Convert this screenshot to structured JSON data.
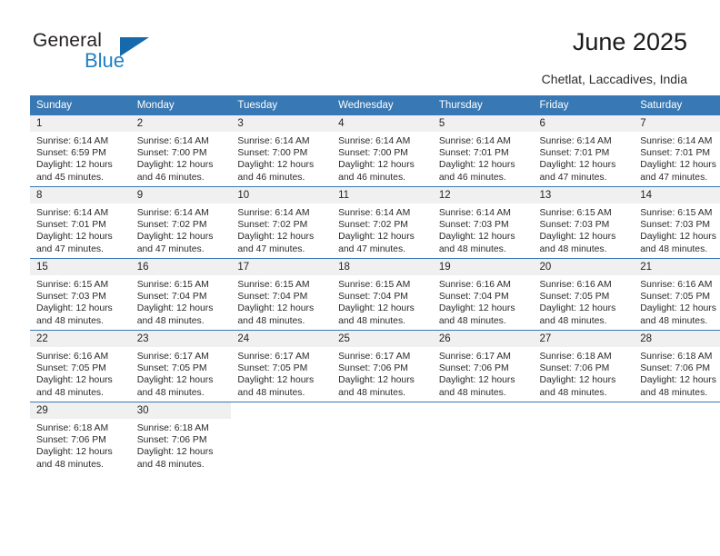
{
  "brand": {
    "name_part1": "General",
    "name_part2": "Blue",
    "color_dark": "#231f20",
    "color_blue": "#1f7fc4"
  },
  "header": {
    "title": "June 2025",
    "subtitle": "Chetlat, Laccadives, India"
  },
  "theme": {
    "header_bg": "#3878b4",
    "header_text": "#ffffff",
    "daynum_bg": "#f0f0f0",
    "separator": "#3878b4",
    "body_text": "#2a2a2a"
  },
  "weekday_headers": [
    "Sunday",
    "Monday",
    "Tuesday",
    "Wednesday",
    "Thursday",
    "Friday",
    "Saturday"
  ],
  "weeks": [
    [
      {
        "day": "1",
        "sunrise": "Sunrise: 6:14 AM",
        "sunset": "Sunset: 6:59 PM",
        "daylight1": "Daylight: 12 hours",
        "daylight2": "and 45 minutes."
      },
      {
        "day": "2",
        "sunrise": "Sunrise: 6:14 AM",
        "sunset": "Sunset: 7:00 PM",
        "daylight1": "Daylight: 12 hours",
        "daylight2": "and 46 minutes."
      },
      {
        "day": "3",
        "sunrise": "Sunrise: 6:14 AM",
        "sunset": "Sunset: 7:00 PM",
        "daylight1": "Daylight: 12 hours",
        "daylight2": "and 46 minutes."
      },
      {
        "day": "4",
        "sunrise": "Sunrise: 6:14 AM",
        "sunset": "Sunset: 7:00 PM",
        "daylight1": "Daylight: 12 hours",
        "daylight2": "and 46 minutes."
      },
      {
        "day": "5",
        "sunrise": "Sunrise: 6:14 AM",
        "sunset": "Sunset: 7:01 PM",
        "daylight1": "Daylight: 12 hours",
        "daylight2": "and 46 minutes."
      },
      {
        "day": "6",
        "sunrise": "Sunrise: 6:14 AM",
        "sunset": "Sunset: 7:01 PM",
        "daylight1": "Daylight: 12 hours",
        "daylight2": "and 47 minutes."
      },
      {
        "day": "7",
        "sunrise": "Sunrise: 6:14 AM",
        "sunset": "Sunset: 7:01 PM",
        "daylight1": "Daylight: 12 hours",
        "daylight2": "and 47 minutes."
      }
    ],
    [
      {
        "day": "8",
        "sunrise": "Sunrise: 6:14 AM",
        "sunset": "Sunset: 7:01 PM",
        "daylight1": "Daylight: 12 hours",
        "daylight2": "and 47 minutes."
      },
      {
        "day": "9",
        "sunrise": "Sunrise: 6:14 AM",
        "sunset": "Sunset: 7:02 PM",
        "daylight1": "Daylight: 12 hours",
        "daylight2": "and 47 minutes."
      },
      {
        "day": "10",
        "sunrise": "Sunrise: 6:14 AM",
        "sunset": "Sunset: 7:02 PM",
        "daylight1": "Daylight: 12 hours",
        "daylight2": "and 47 minutes."
      },
      {
        "day": "11",
        "sunrise": "Sunrise: 6:14 AM",
        "sunset": "Sunset: 7:02 PM",
        "daylight1": "Daylight: 12 hours",
        "daylight2": "and 47 minutes."
      },
      {
        "day": "12",
        "sunrise": "Sunrise: 6:14 AM",
        "sunset": "Sunset: 7:03 PM",
        "daylight1": "Daylight: 12 hours",
        "daylight2": "and 48 minutes."
      },
      {
        "day": "13",
        "sunrise": "Sunrise: 6:15 AM",
        "sunset": "Sunset: 7:03 PM",
        "daylight1": "Daylight: 12 hours",
        "daylight2": "and 48 minutes."
      },
      {
        "day": "14",
        "sunrise": "Sunrise: 6:15 AM",
        "sunset": "Sunset: 7:03 PM",
        "daylight1": "Daylight: 12 hours",
        "daylight2": "and 48 minutes."
      }
    ],
    [
      {
        "day": "15",
        "sunrise": "Sunrise: 6:15 AM",
        "sunset": "Sunset: 7:03 PM",
        "daylight1": "Daylight: 12 hours",
        "daylight2": "and 48 minutes."
      },
      {
        "day": "16",
        "sunrise": "Sunrise: 6:15 AM",
        "sunset": "Sunset: 7:04 PM",
        "daylight1": "Daylight: 12 hours",
        "daylight2": "and 48 minutes."
      },
      {
        "day": "17",
        "sunrise": "Sunrise: 6:15 AM",
        "sunset": "Sunset: 7:04 PM",
        "daylight1": "Daylight: 12 hours",
        "daylight2": "and 48 minutes."
      },
      {
        "day": "18",
        "sunrise": "Sunrise: 6:15 AM",
        "sunset": "Sunset: 7:04 PM",
        "daylight1": "Daylight: 12 hours",
        "daylight2": "and 48 minutes."
      },
      {
        "day": "19",
        "sunrise": "Sunrise: 6:16 AM",
        "sunset": "Sunset: 7:04 PM",
        "daylight1": "Daylight: 12 hours",
        "daylight2": "and 48 minutes."
      },
      {
        "day": "20",
        "sunrise": "Sunrise: 6:16 AM",
        "sunset": "Sunset: 7:05 PM",
        "daylight1": "Daylight: 12 hours",
        "daylight2": "and 48 minutes."
      },
      {
        "day": "21",
        "sunrise": "Sunrise: 6:16 AM",
        "sunset": "Sunset: 7:05 PM",
        "daylight1": "Daylight: 12 hours",
        "daylight2": "and 48 minutes."
      }
    ],
    [
      {
        "day": "22",
        "sunrise": "Sunrise: 6:16 AM",
        "sunset": "Sunset: 7:05 PM",
        "daylight1": "Daylight: 12 hours",
        "daylight2": "and 48 minutes."
      },
      {
        "day": "23",
        "sunrise": "Sunrise: 6:17 AM",
        "sunset": "Sunset: 7:05 PM",
        "daylight1": "Daylight: 12 hours",
        "daylight2": "and 48 minutes."
      },
      {
        "day": "24",
        "sunrise": "Sunrise: 6:17 AM",
        "sunset": "Sunset: 7:05 PM",
        "daylight1": "Daylight: 12 hours",
        "daylight2": "and 48 minutes."
      },
      {
        "day": "25",
        "sunrise": "Sunrise: 6:17 AM",
        "sunset": "Sunset: 7:06 PM",
        "daylight1": "Daylight: 12 hours",
        "daylight2": "and 48 minutes."
      },
      {
        "day": "26",
        "sunrise": "Sunrise: 6:17 AM",
        "sunset": "Sunset: 7:06 PM",
        "daylight1": "Daylight: 12 hours",
        "daylight2": "and 48 minutes."
      },
      {
        "day": "27",
        "sunrise": "Sunrise: 6:18 AM",
        "sunset": "Sunset: 7:06 PM",
        "daylight1": "Daylight: 12 hours",
        "daylight2": "and 48 minutes."
      },
      {
        "day": "28",
        "sunrise": "Sunrise: 6:18 AM",
        "sunset": "Sunset: 7:06 PM",
        "daylight1": "Daylight: 12 hours",
        "daylight2": "and 48 minutes."
      }
    ],
    [
      {
        "day": "29",
        "sunrise": "Sunrise: 6:18 AM",
        "sunset": "Sunset: 7:06 PM",
        "daylight1": "Daylight: 12 hours",
        "daylight2": "and 48 minutes."
      },
      {
        "day": "30",
        "sunrise": "Sunrise: 6:18 AM",
        "sunset": "Sunset: 7:06 PM",
        "daylight1": "Daylight: 12 hours",
        "daylight2": "and 48 minutes."
      },
      {
        "day": "",
        "sunrise": "",
        "sunset": "",
        "daylight1": "",
        "daylight2": ""
      },
      {
        "day": "",
        "sunrise": "",
        "sunset": "",
        "daylight1": "",
        "daylight2": ""
      },
      {
        "day": "",
        "sunrise": "",
        "sunset": "",
        "daylight1": "",
        "daylight2": ""
      },
      {
        "day": "",
        "sunrise": "",
        "sunset": "",
        "daylight1": "",
        "daylight2": ""
      },
      {
        "day": "",
        "sunrise": "",
        "sunset": "",
        "daylight1": "",
        "daylight2": ""
      }
    ]
  ]
}
